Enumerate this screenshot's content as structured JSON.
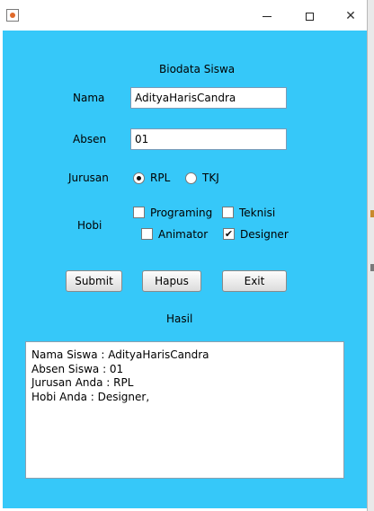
{
  "window": {
    "title": ""
  },
  "form": {
    "heading": "Biodata Siswa",
    "nama": {
      "label": "Nama",
      "value": "AdityaHarisCandra"
    },
    "absen": {
      "label": "Absen",
      "value": "01"
    },
    "jurusan": {
      "label": "Jurusan",
      "options": [
        {
          "label": "RPL",
          "selected": true
        },
        {
          "label": "TKJ",
          "selected": false
        }
      ]
    },
    "hobi": {
      "label": "Hobi",
      "options": [
        {
          "label": "Programing",
          "checked": false
        },
        {
          "label": "Teknisi",
          "checked": false
        },
        {
          "label": "Animator",
          "checked": false
        },
        {
          "label": "Designer",
          "checked": true
        }
      ]
    },
    "buttons": {
      "submit": "Submit",
      "hapus": "Hapus",
      "exit": "Exit"
    },
    "hasil_label": "Hasil",
    "hasil_lines": [
      "Nama Siswa : AdityaHarisCandra",
      "Absen Siswa : 01",
      "Jurusan Anda : RPL",
      "Hobi Anda : Designer,"
    ]
  },
  "colors": {
    "panel_background": "#36c8f9"
  },
  "icons": {
    "app": "java-cup-icon",
    "minimize": "minimize-icon",
    "maximize": "maximize-icon",
    "close": "close-icon",
    "check": "checkmark-icon"
  }
}
